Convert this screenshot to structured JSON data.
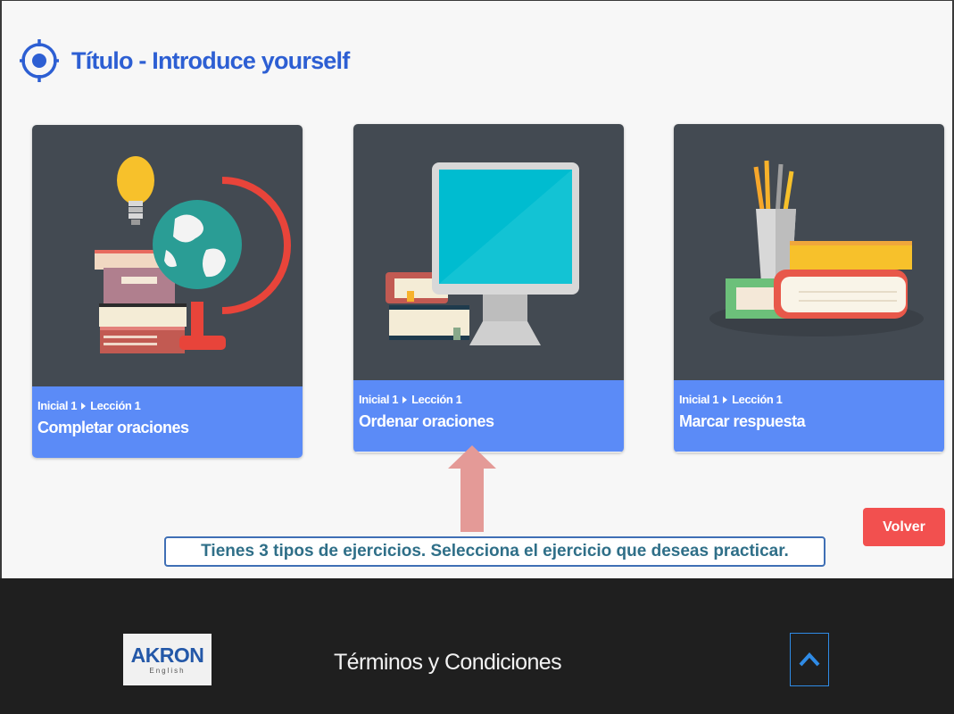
{
  "header": {
    "title": "Título - Introduce yourself",
    "icon": "target-icon"
  },
  "cards": [
    {
      "level": "Inicial 1",
      "lesson": "Lección 1",
      "title": "Completar oraciones",
      "illustration": "books-globe-lightbulb"
    },
    {
      "level": "Inicial 1",
      "lesson": "Lección 1",
      "title": "Ordenar oraciones",
      "illustration": "books-computer-monitor"
    },
    {
      "level": "Inicial 1",
      "lesson": "Lección 1",
      "title": "Marcar respuesta",
      "illustration": "books-pencil-cup"
    }
  ],
  "hint": {
    "text": "Tienes 3 tipos de ejercicios. Selecciona el ejercicio que deseas practicar.",
    "arrow_icon": "up-arrow-icon"
  },
  "back_button": {
    "label": "Volver"
  },
  "footer": {
    "logo_text": "AKRON",
    "logo_subtext": "English",
    "terms_label": "Términos y Condiciones",
    "scroll_top_icon": "chevron-up-icon"
  },
  "colors": {
    "accent_blue": "#2d5fd3",
    "card_info_bg": "#5b8bf7",
    "card_art_bg": "#434a52",
    "back_button_bg": "#f2504f",
    "footer_bg": "#1f1f1f",
    "hint_text": "#2f6f88"
  }
}
